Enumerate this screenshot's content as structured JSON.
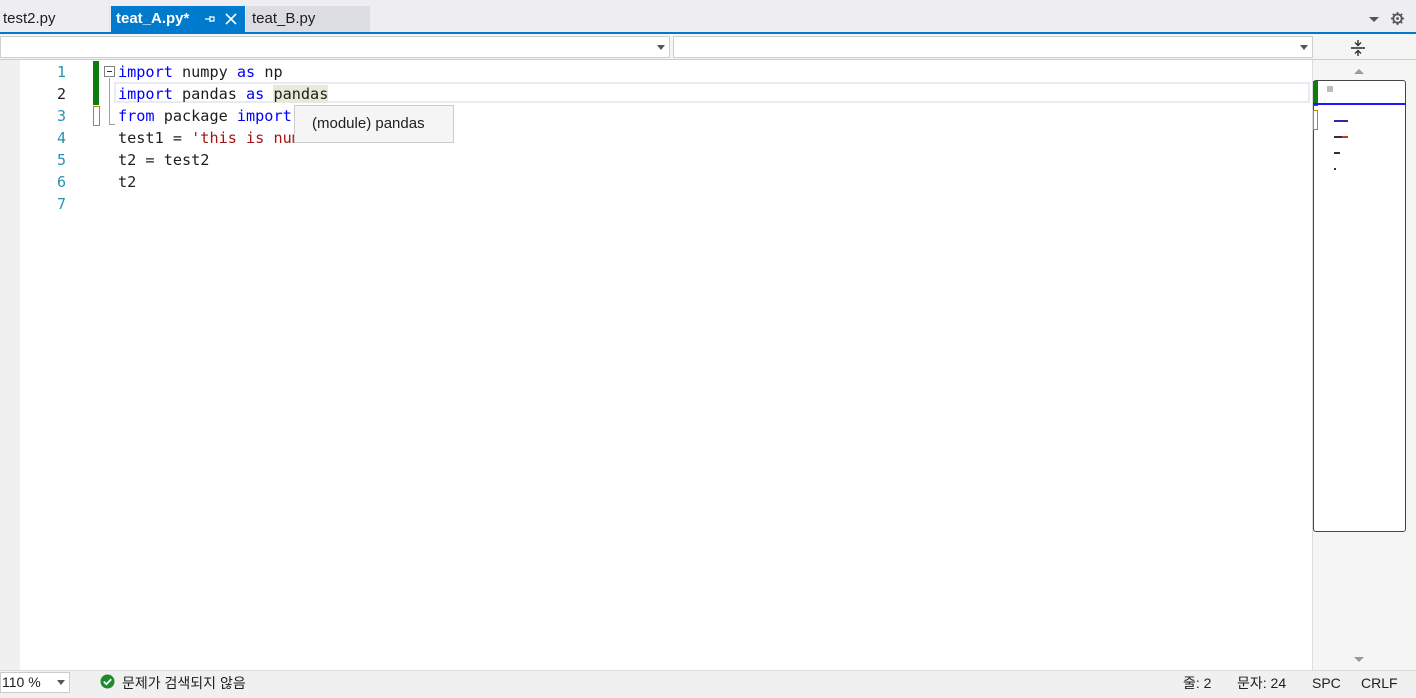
{
  "tabs": [
    {
      "label": "test2.py",
      "active": false
    },
    {
      "label": "teat_A.py*",
      "active": true
    },
    {
      "label": "teat_B.py",
      "active": false
    }
  ],
  "code": {
    "line_numbers": [
      "1",
      "2",
      "3",
      "4",
      "5",
      "6",
      "7"
    ],
    "lines": {
      "l1": {
        "kw1": "import",
        "t1": " numpy ",
        "kw2": "as",
        "t2": " np"
      },
      "l2": {
        "kw1": "import",
        "t1": " pandas ",
        "kw2": "as",
        "t2": " ",
        "hl": "pandas"
      },
      "l3": {
        "kw1": "from",
        "t1": " package ",
        "kw2": "import"
      },
      "l4": {
        "t1": "test1 = ",
        "str": "'this is num"
      },
      "l5": {
        "t1": "t2 = test2"
      },
      "l6": {
        "t1": "t2"
      }
    }
  },
  "tooltip": {
    "text": "(module) pandas"
  },
  "statusbar": {
    "zoom": "110 %",
    "issues": "문제가 검색되지 않음",
    "line": "줄: 2",
    "char": "문자: 24",
    "spacing": "SPC",
    "line_ending": "CRLF"
  },
  "colors": {
    "accent": "#007acc",
    "keyword": "#0000ff",
    "string": "#a31515",
    "line_number": "#2b91af",
    "change_saved": "#107c10",
    "change_unsaved": "#b68b00",
    "ok": "#1e8a2e"
  },
  "icons": [
    "pin-icon",
    "close-icon",
    "tab-overflow-icon",
    "settings-icon",
    "split-icon",
    "fold-icon",
    "scroll-up-icon",
    "scroll-down-icon",
    "check-circle-icon"
  ]
}
